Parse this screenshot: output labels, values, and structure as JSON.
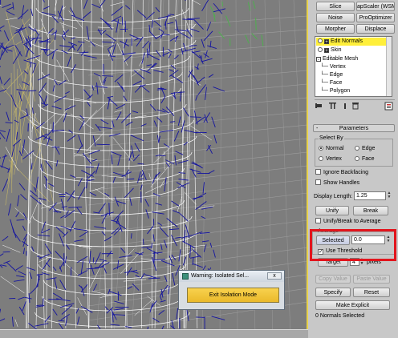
{
  "modifier_buttons": [
    {
      "label": "Slice"
    },
    {
      "label": "apScaler (WSM"
    },
    {
      "label": "Noise"
    },
    {
      "label": "ProOptimizer"
    },
    {
      "label": "Morpher"
    },
    {
      "label": "Displace"
    }
  ],
  "stack": {
    "items": [
      {
        "label": "Edit Normals",
        "selected": true
      },
      {
        "label": "Skin",
        "selected": false
      },
      {
        "label": "Editable Mesh",
        "selected": false
      }
    ],
    "sub_items": [
      "Vertex",
      "Edge",
      "Face",
      "Polygon"
    ]
  },
  "stack_toolbar_icons": [
    "pin-stack-icon",
    "show-end-result-icon",
    "make-unique-icon",
    "remove-modifier-icon",
    "configure-modifier-sets-icon"
  ],
  "parameters": {
    "rollout_sign": "-",
    "title": "Parameters",
    "select_by_label": "Select By",
    "radios": [
      "Normal",
      "Edge",
      "Vertex",
      "Face"
    ],
    "selected_radio": "Normal",
    "ignore_backfacing": "Ignore Backfacing",
    "show_handles": "Show Handles",
    "display_length_label": "Display Length:",
    "display_length_value": "1.25",
    "unify": "Unify",
    "break": "Break",
    "unify_break_avg": "Unify/Break to Average",
    "average_label": "Average",
    "selected_btn": "Selected",
    "selected_value": "0.0",
    "use_threshold": "Use Threshold",
    "use_threshold_checked": true,
    "target_btn": "Target",
    "target_value": "4",
    "target_unit": "pixels",
    "copy_value": "Copy Value",
    "paste_value": "Paste Value",
    "specify": "Specify",
    "reset": "Reset",
    "make_explicit": "Make Explicit",
    "status": "0 Normals Selected"
  },
  "dialog": {
    "title": "Warning: Isolated Sel...",
    "close": "x",
    "button": "Exit Isolation Mode"
  },
  "colors": {
    "viewport_bg": "#7d7d7d",
    "normals": "#1414a0",
    "highlight": "#e2141c",
    "stack_selected": "#ffef3a"
  }
}
